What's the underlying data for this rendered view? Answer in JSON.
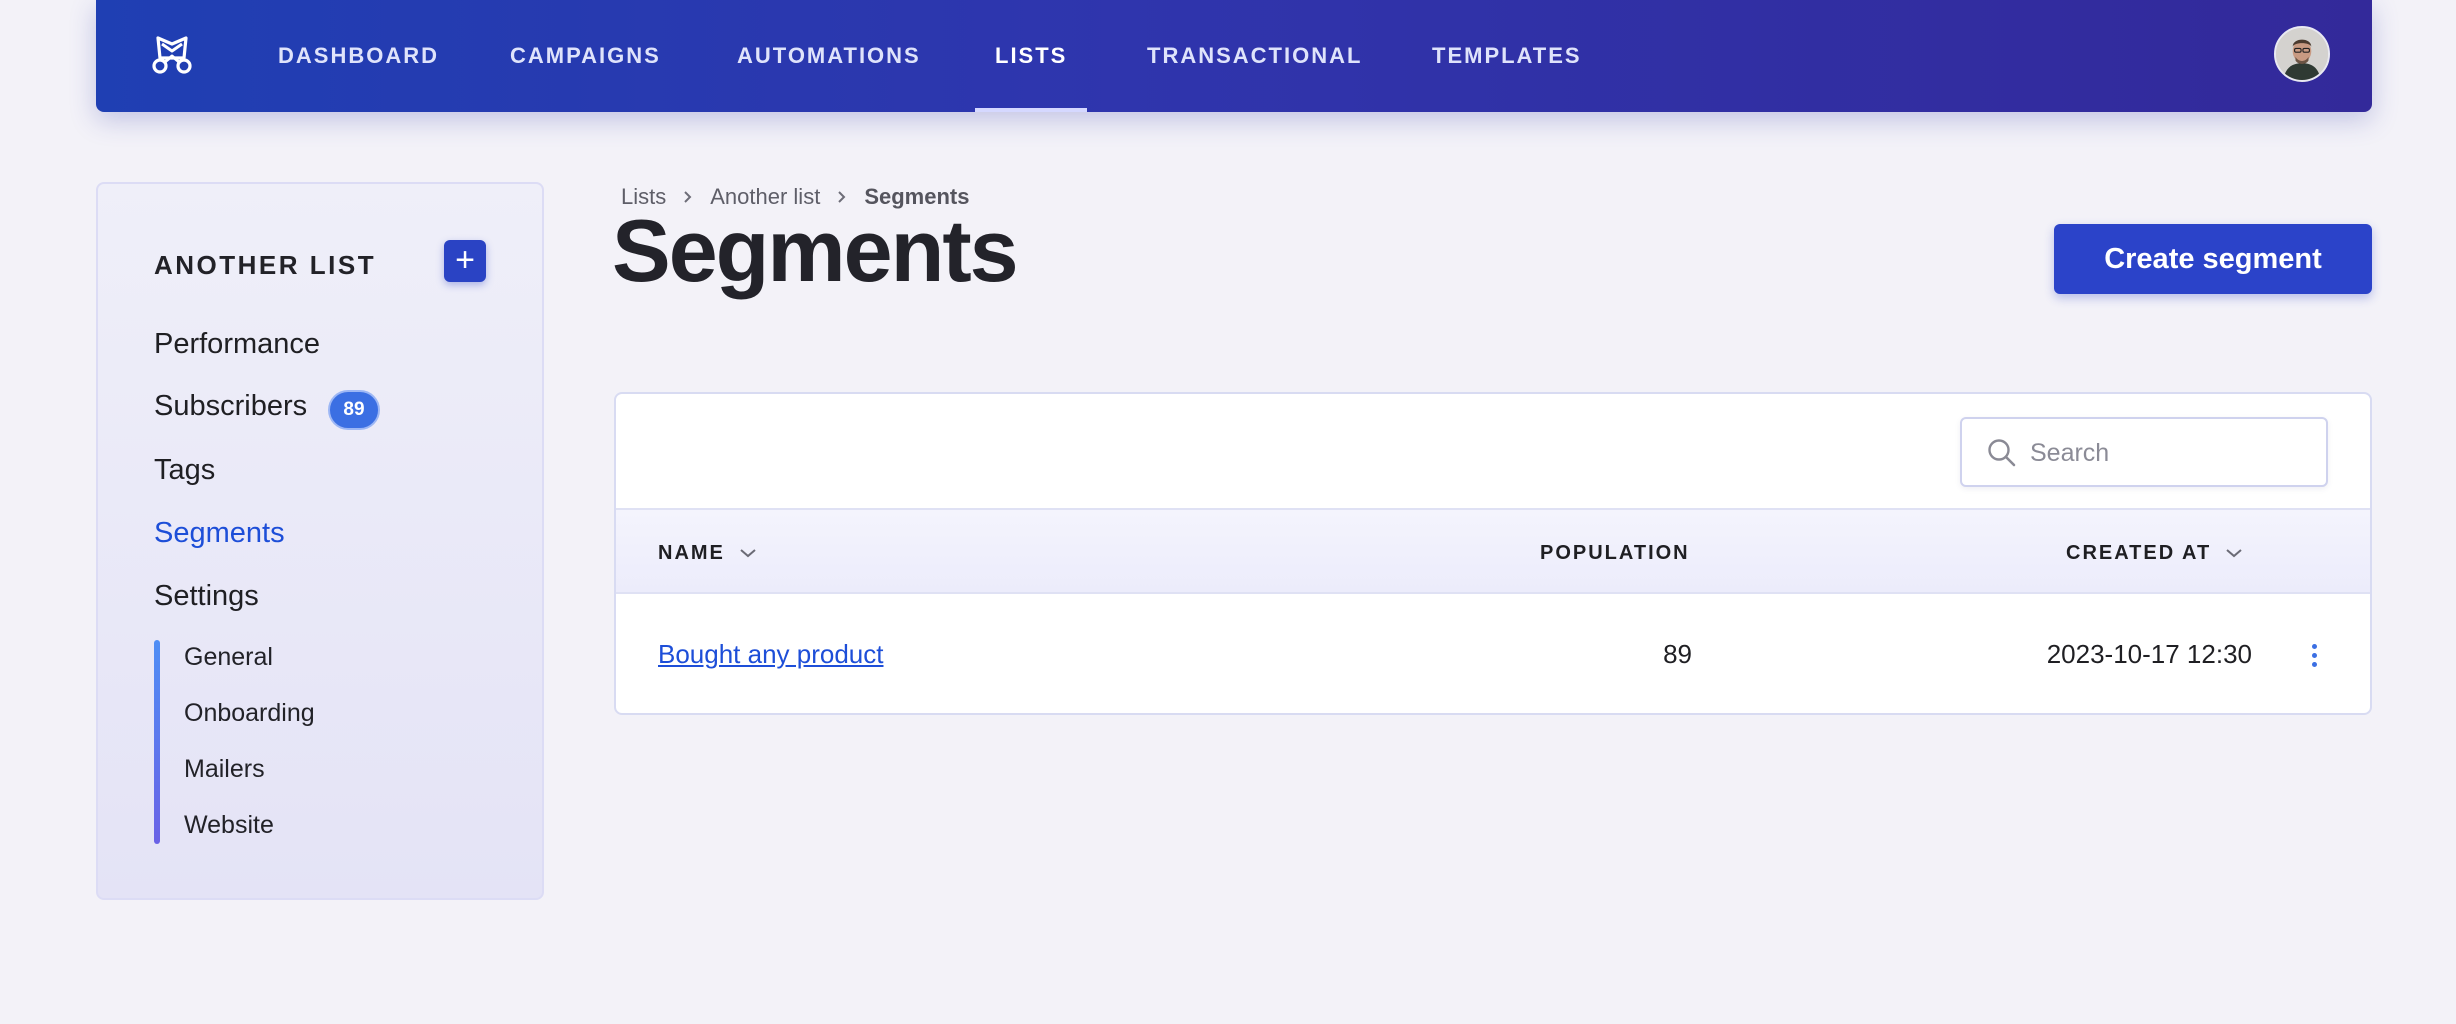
{
  "nav": {
    "items": [
      {
        "label": "DASHBOARD"
      },
      {
        "label": "CAMPAIGNS"
      },
      {
        "label": "AUTOMATIONS"
      },
      {
        "label": "LISTS",
        "active": true
      },
      {
        "label": "TRANSACTIONAL"
      },
      {
        "label": "TEMPLATES"
      }
    ],
    "logo_icon": "mailcoach-logo-icon",
    "avatar_icon": "user-avatar"
  },
  "sidebar": {
    "title": "ANOTHER LIST",
    "add_button_icon": "plus-icon",
    "items": [
      {
        "label": "Performance"
      },
      {
        "label": "Subscribers",
        "badge": "89"
      },
      {
        "label": "Tags"
      },
      {
        "label": "Segments",
        "active": true
      },
      {
        "label": "Settings"
      }
    ],
    "settings_items": [
      {
        "label": "General"
      },
      {
        "label": "Onboarding"
      },
      {
        "label": "Mailers"
      },
      {
        "label": "Website"
      }
    ]
  },
  "breadcrumb": {
    "items": [
      "Lists",
      "Another list",
      "Segments"
    ]
  },
  "page": {
    "title": "Segments",
    "create_button": "Create segment"
  },
  "table": {
    "search_placeholder": "Search",
    "search_value": "",
    "columns": [
      "NAME",
      "POPULATION",
      "CREATED AT"
    ],
    "rows": [
      {
        "name": "Bought any product",
        "population": "89",
        "created_at": "2023-10-17 12:30"
      }
    ]
  },
  "colors": {
    "nav_gradient_start": "#1f3fb3",
    "nav_gradient_end": "#33299a",
    "accent_blue": "#2b43c9",
    "link_blue": "#1d4ed8",
    "badge_blue": "#3b6fe3",
    "background": "#f3f2f8"
  }
}
